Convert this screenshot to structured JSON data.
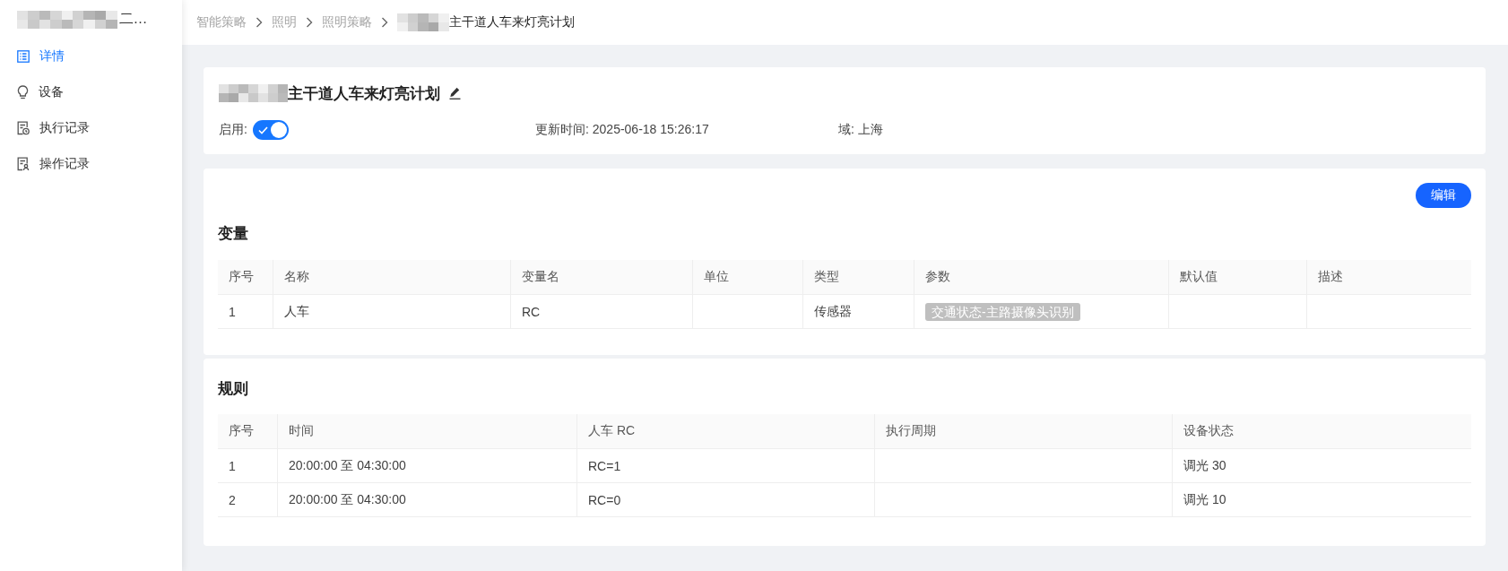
{
  "sidebar": {
    "title": {
      "redacted": true,
      "text": "二…"
    },
    "items": [
      {
        "label": "详情",
        "selected": true
      },
      {
        "label": "设备",
        "selected": false
      },
      {
        "label": "执行记录",
        "selected": false
      },
      {
        "label": "操作记录",
        "selected": false
      }
    ]
  },
  "breadcrumb": [
    {
      "label": "智能策略",
      "current": false,
      "redacted": false
    },
    {
      "label": "照明",
      "current": false,
      "redacted": false
    },
    {
      "label": "照明策略",
      "current": false,
      "redacted": false
    },
    {
      "label": "主干道人车来灯亮计划",
      "current": true,
      "redacted": true
    }
  ],
  "summary": {
    "title": {
      "redacted": true,
      "text": "主干道人车来灯亮计划"
    },
    "enabled": {
      "label": "启用:",
      "on": true
    },
    "updated": "更新时间: 2025-06-18 15:26:17",
    "domain": "域: 上海"
  },
  "edit_button": "编辑",
  "variables": {
    "heading": "变量",
    "columns": [
      "序号",
      "名称",
      "变量名",
      "单位",
      "类型",
      "参数",
      "默认值",
      "描述"
    ],
    "rows": [
      [
        {
          "kind": "text",
          "text": "1"
        },
        {
          "kind": "text",
          "text": "人车"
        },
        {
          "kind": "text",
          "text": "RC"
        },
        {
          "kind": "empty"
        },
        {
          "kind": "text",
          "text": "传感器"
        },
        {
          "kind": "tags",
          "tags": [
            "交通状态-主路摄像头识别"
          ]
        },
        {
          "kind": "empty"
        },
        {
          "kind": "empty"
        }
      ]
    ]
  },
  "rules": {
    "heading": "规则",
    "columns": [
      "序号",
      "时间",
      "人车 RC",
      "执行周期",
      "设备状态"
    ],
    "rows": [
      [
        {
          "kind": "text",
          "text": "1"
        },
        {
          "kind": "text",
          "text": "20:00:00 至 04:30:00"
        },
        {
          "kind": "text",
          "text": "RC=1"
        },
        {
          "kind": "empty"
        },
        {
          "kind": "text",
          "text": "调光 30"
        }
      ],
      [
        {
          "kind": "text",
          "text": "2"
        },
        {
          "kind": "text",
          "text": "20:00:00 至 04:30:00"
        },
        {
          "kind": "text",
          "text": "RC=0"
        },
        {
          "kind": "empty"
        },
        {
          "kind": "text",
          "text": "调光 10"
        }
      ]
    ]
  }
}
